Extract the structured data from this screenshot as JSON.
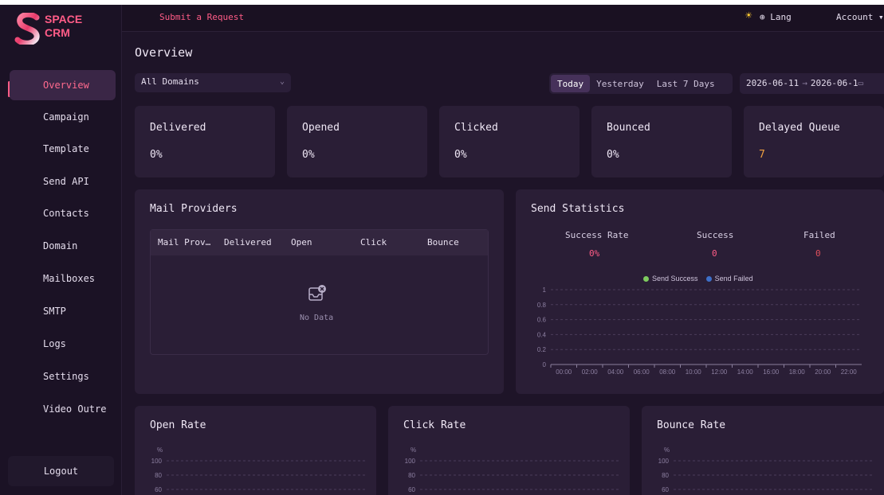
{
  "brand": {
    "line1": "SPACE",
    "line2": "CRM"
  },
  "header": {
    "submit_request": "Submit a Request",
    "theme_icon": "sun-icon",
    "lang": "⊕ Lang",
    "account": "Account ▾"
  },
  "sidebar": {
    "items": [
      {
        "label": "Overview",
        "active": true
      },
      {
        "label": "Campaign"
      },
      {
        "label": "Template"
      },
      {
        "label": "Send API"
      },
      {
        "label": "Contacts"
      },
      {
        "label": "Domain"
      },
      {
        "label": "Mailboxes"
      },
      {
        "label": "SMTP"
      },
      {
        "label": "Logs"
      },
      {
        "label": "Settings"
      },
      {
        "label": "Video Outre"
      }
    ],
    "logout": "Logout"
  },
  "page": {
    "title": "Overview"
  },
  "filters": {
    "domain": "All Domains",
    "ranges": [
      "Today",
      "Yesterday",
      "Last 7 Days"
    ],
    "active_range": "Today",
    "date_start": "2026-06-11",
    "date_end": "2026-06-1"
  },
  "stats": [
    {
      "label": "Delivered",
      "value": "0%"
    },
    {
      "label": "Opened",
      "value": "0%"
    },
    {
      "label": "Clicked",
      "value": "0%"
    },
    {
      "label": "Bounced",
      "value": "0%"
    },
    {
      "label": "Delayed Queue",
      "value": "7"
    }
  ],
  "mail_providers": {
    "title": "Mail Providers",
    "columns": [
      "Mail Prov…",
      "Delivered",
      "Open",
      "Click",
      "Bounce"
    ],
    "empty": "No Data"
  },
  "send_statistics": {
    "title": "Send Statistics",
    "metrics": [
      {
        "label": "Success Rate",
        "value": "0%"
      },
      {
        "label": "Success",
        "value": "0"
      },
      {
        "label": "Failed",
        "value": "0"
      }
    ]
  },
  "colors": {
    "accent": "#ff5c87",
    "success_series": "#7ecb5f",
    "failed_series": "#3d6fc8",
    "failed_value": "#e0505c",
    "queue_value": "#f0a040"
  },
  "chart_data": [
    {
      "type": "line",
      "series": [
        {
          "name": "Send Success",
          "values": [
            0,
            0,
            0,
            0,
            0,
            0,
            0,
            0,
            0,
            0,
            0,
            0
          ]
        },
        {
          "name": "Send Failed",
          "values": [
            0,
            0,
            0,
            0,
            0,
            0,
            0,
            0,
            0,
            0,
            0,
            0
          ]
        }
      ],
      "categories": [
        "00:00",
        "02:00",
        "04:00",
        "06:00",
        "08:00",
        "10:00",
        "12:00",
        "14:00",
        "16:00",
        "18:00",
        "20:00",
        "22:00"
      ],
      "yticks": [
        "0",
        "0.2",
        "0.4",
        "0.6",
        "0.8",
        "1"
      ],
      "ylim": [
        0,
        1
      ],
      "grid": true,
      "legend": "top-center"
    },
    {
      "type": "line",
      "title": "Open Rate",
      "ylabel": "%",
      "yticks": [
        "100",
        "80",
        "60"
      ],
      "ylim": [
        0,
        100
      ],
      "grid": true
    },
    {
      "type": "line",
      "title": "Click Rate",
      "ylabel": "%",
      "yticks": [
        "100",
        "80",
        "60"
      ],
      "ylim": [
        0,
        100
      ],
      "grid": true
    },
    {
      "type": "line",
      "title": "Bounce Rate",
      "ylabel": "%",
      "yticks": [
        "100",
        "80",
        "60"
      ],
      "ylim": [
        0,
        100
      ],
      "grid": true
    }
  ]
}
